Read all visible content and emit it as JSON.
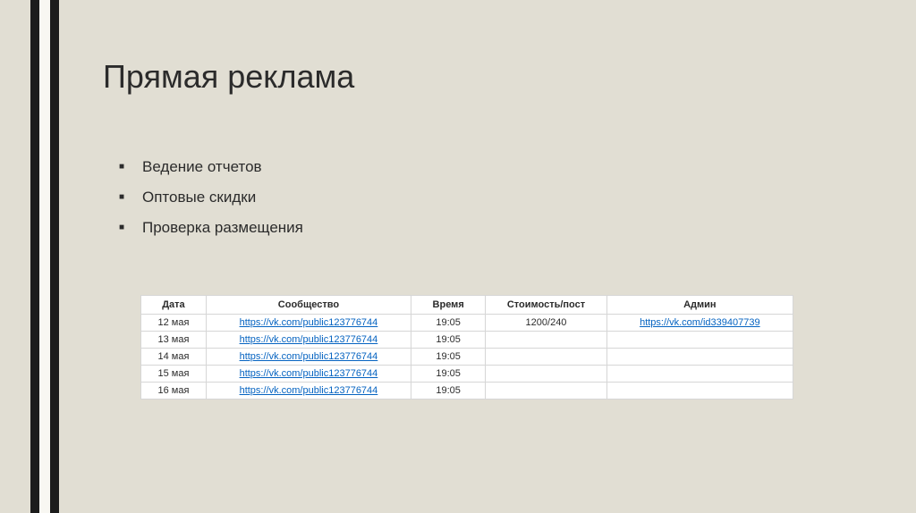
{
  "title": "Прямая реклама",
  "bullets": [
    "Ведение отчетов",
    "Оптовые скидки",
    "Проверка размещения"
  ],
  "table": {
    "headers": {
      "date": "Дата",
      "community": "Сообщество",
      "time": "Время",
      "cost": "Стоимость/пост",
      "admin": "Админ"
    },
    "rows": [
      {
        "date": "12 мая",
        "community": "https://vk.com/public123776744",
        "time": "19:05",
        "cost": "1200/240",
        "admin": "https://vk.com/id339407739"
      },
      {
        "date": "13 мая",
        "community": "https://vk.com/public123776744",
        "time": "19:05",
        "cost": "",
        "admin": ""
      },
      {
        "date": "14 мая",
        "community": "https://vk.com/public123776744",
        "time": "19:05",
        "cost": "",
        "admin": ""
      },
      {
        "date": "15 мая",
        "community": "https://vk.com/public123776744",
        "time": "19:05",
        "cost": "",
        "admin": ""
      },
      {
        "date": "16 мая",
        "community": "https://vk.com/public123776744",
        "time": "19:05",
        "cost": "",
        "admin": ""
      }
    ]
  }
}
